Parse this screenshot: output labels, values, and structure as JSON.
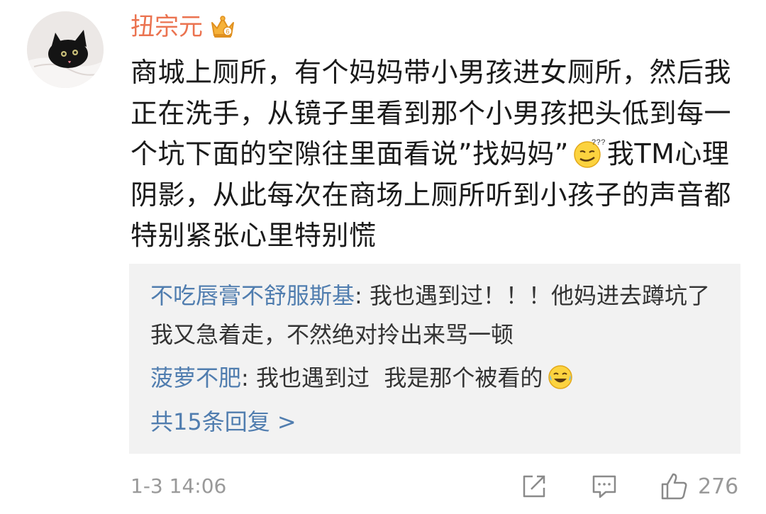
{
  "post": {
    "author": "扭宗元",
    "text_before_emoji": "商城上厕所，有个妈妈带小男孩进女厕所，然后我正在洗手，从镜子里看到那个小男孩把头低到每一个坑下面的空隙往里面看说”找妈妈”",
    "text_after_emoji": "我TM心理阴影，从此每次在商场上厕所听到小孩子的声音都特别紧张心里特别慌"
  },
  "replies": [
    {
      "user": "不吃唇膏不舒服斯基",
      "separator": ": ",
      "text": "我也遇到过！！！他妈进去蹲坑了我又急着走，不然绝对拎出来骂一顿"
    },
    {
      "user": "菠萝不肥",
      "separator": ": ",
      "text": "我也遇到过  我是那个被看的"
    }
  ],
  "more_replies": "共15条回复 >",
  "footer": {
    "timestamp": "1-3 14:06",
    "like_count": "276"
  },
  "icons": [
    "crown-icon",
    "confused-emoji-icon",
    "laugh-cry-emoji-icon",
    "share-icon",
    "comment-icon",
    "like-icon"
  ]
}
